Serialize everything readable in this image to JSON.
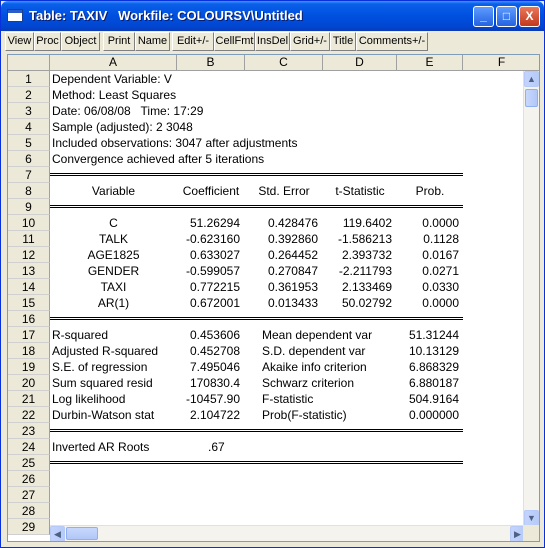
{
  "window": {
    "title": "Table: TAXIV   Workfile: COLOURSV\\Untitled"
  },
  "title_buttons": [
    "_",
    "□",
    "X"
  ],
  "toolbar": [
    "View",
    "Proc",
    "Object",
    "Print",
    "Name",
    "Edit+/-",
    "CellFmt",
    "InsDel",
    "Grid+/-",
    "Title",
    "Comments+/-"
  ],
  "columns": [
    "A",
    "B",
    "C",
    "D",
    "E",
    "F"
  ],
  "rows": [
    "1",
    "2",
    "3",
    "4",
    "5",
    "6",
    "7",
    "8",
    "9",
    "10",
    "11",
    "12",
    "13",
    "14",
    "15",
    "16",
    "17",
    "18",
    "19",
    "20",
    "21",
    "22",
    "23",
    "24",
    "25",
    "26",
    "27",
    "28",
    "29"
  ],
  "header_info": [
    "Dependent Variable: V",
    "Method: Least Squares",
    "Date: 06/08/08   Time: 17:29",
    "Sample (adjusted): 2 3048",
    "Included observations: 3047 after adjustments",
    "Convergence achieved after 5 iterations"
  ],
  "coef_headers": [
    "Variable",
    "Coefficient",
    "Std. Error",
    "t-Statistic",
    "Prob."
  ],
  "coef_rows": [
    [
      "C",
      "51.26294",
      "0.428476",
      "119.6402",
      "0.0000"
    ],
    [
      "TALK",
      "-0.623160",
      "0.392860",
      "-1.586213",
      "0.1128"
    ],
    [
      "AGE1825",
      "0.633027",
      "0.264452",
      "2.393732",
      "0.0167"
    ],
    [
      "GENDER",
      "-0.599057",
      "0.270847",
      "-2.211793",
      "0.0271"
    ],
    [
      "TAXI",
      "0.772215",
      "0.361953",
      "2.133469",
      "0.0330"
    ],
    [
      "AR(1)",
      "0.672001",
      "0.013433",
      "50.02792",
      "0.0000"
    ]
  ],
  "stats_rows": [
    [
      "R-squared",
      "0.453606",
      "Mean dependent var",
      "51.31244"
    ],
    [
      "Adjusted R-squared",
      "0.452708",
      "S.D. dependent var",
      "10.13129"
    ],
    [
      "S.E. of regression",
      "7.495046",
      "Akaike info criterion",
      "6.868329"
    ],
    [
      "Sum squared resid",
      "170830.4",
      "Schwarz criterion",
      "6.880187"
    ],
    [
      "Log likelihood",
      "-10457.90",
      "F-statistic",
      "504.9164"
    ],
    [
      "Durbin-Watson stat",
      "2.104722",
      "Prob(F-statistic)",
      "0.000000"
    ]
  ],
  "roots": {
    "label": "Inverted AR Roots",
    "value": ".67"
  },
  "scroll_arrows": {
    "up": "▲",
    "down": "▼",
    "left": "◀",
    "right": "▶"
  }
}
